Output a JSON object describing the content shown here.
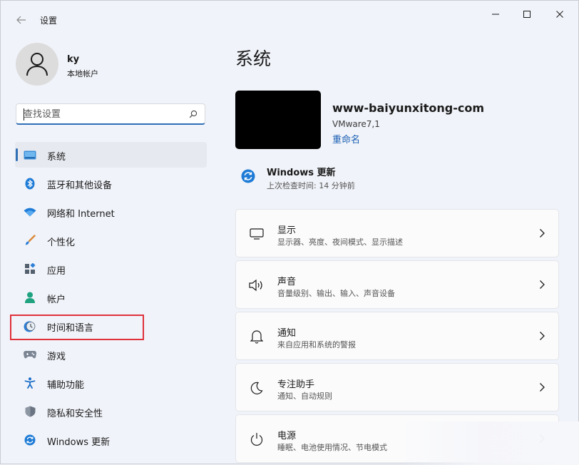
{
  "window": {
    "title": "设置"
  },
  "profile": {
    "name": "ky",
    "account_type": "本地帐户"
  },
  "search": {
    "placeholder": "查找设置"
  },
  "sidebar": {
    "items": [
      {
        "label": "系统",
        "icon": "system-display-icon",
        "active": true
      },
      {
        "label": "蓝牙和其他设备",
        "icon": "bluetooth-icon"
      },
      {
        "label": "网络和 Internet",
        "icon": "wifi-icon"
      },
      {
        "label": "个性化",
        "icon": "brush-icon"
      },
      {
        "label": "应用",
        "icon": "apps-icon"
      },
      {
        "label": "帐户",
        "icon": "account-icon"
      },
      {
        "label": "时间和语言",
        "icon": "clock-globe-icon",
        "highlighted": true
      },
      {
        "label": "游戏",
        "icon": "gamepad-icon"
      },
      {
        "label": "辅助功能",
        "icon": "accessibility-icon"
      },
      {
        "label": "隐私和安全性",
        "icon": "shield-icon"
      },
      {
        "label": "Windows 更新",
        "icon": "update-icon"
      }
    ]
  },
  "main": {
    "title": "系统",
    "device": {
      "name": "www-baiyunxitong-com",
      "model": "VMware7,1",
      "rename_label": "重命名"
    },
    "update": {
      "title": "Windows 更新",
      "subtitle": "上次检查时间: 14 分钟前"
    },
    "cards": [
      {
        "title": "显示",
        "subtitle": "显示器、亮度、夜间模式、显示描述",
        "icon": "monitor-icon"
      },
      {
        "title": "声音",
        "subtitle": "音量级别、输出、输入、声音设备",
        "icon": "speaker-icon"
      },
      {
        "title": "通知",
        "subtitle": "来自应用和系统的警报",
        "icon": "bell-icon"
      },
      {
        "title": "专注助手",
        "subtitle": "通知、自动规则",
        "icon": "moon-icon"
      },
      {
        "title": "电源",
        "subtitle": "睡眠、电池使用情况、节电模式",
        "icon": "power-icon"
      }
    ]
  },
  "colors": {
    "accent": "#2f6fb5",
    "link": "#1b5fb4",
    "highlight_border": "#e0303a",
    "background": "#f0f3f9"
  }
}
